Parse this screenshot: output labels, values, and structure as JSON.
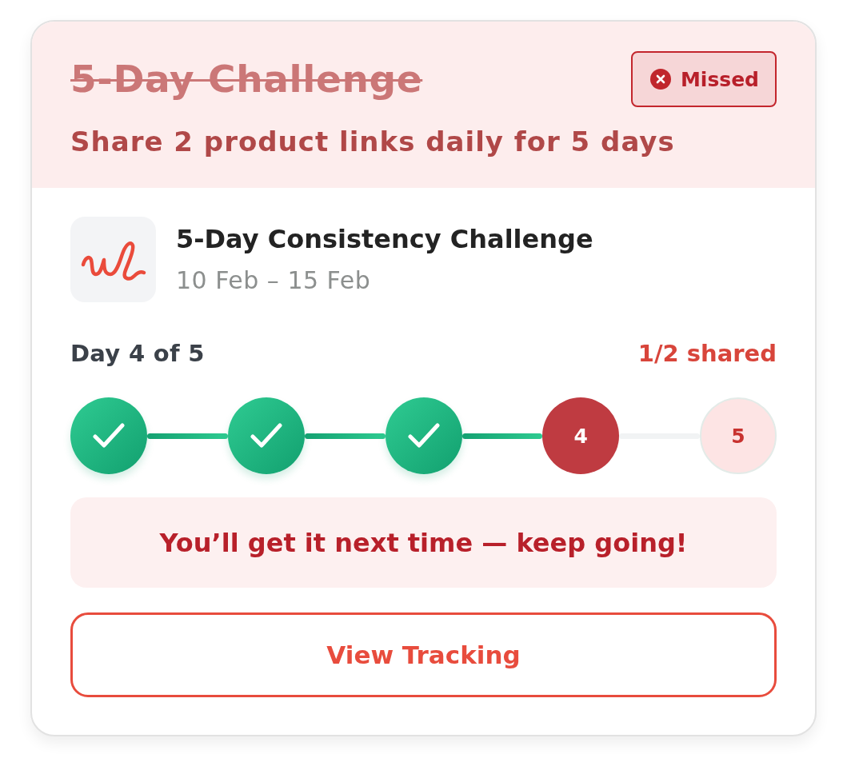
{
  "header": {
    "title": "5-Day Challenge",
    "missed": true,
    "badge": "Missed",
    "subtitle": "Share 2 product links daily for 5 days"
  },
  "challenge": {
    "name": "5-Day Consistency Challenge",
    "dates": "10 Feb – 15 Feb"
  },
  "progress": {
    "day": "Day 4 of 5",
    "shared": "1/2 shared",
    "steps": [
      {
        "completed": true,
        "missed": false
      },
      {
        "completed": true,
        "missed": false
      },
      {
        "completed": true,
        "missed": false
      },
      {
        "completed": false,
        "missed": true,
        "label": "4"
      },
      {
        "completed": false,
        "missed": false,
        "label": "5"
      }
    ]
  },
  "message": "You’ll get it next time — keep going!",
  "button": "View Tracking"
}
